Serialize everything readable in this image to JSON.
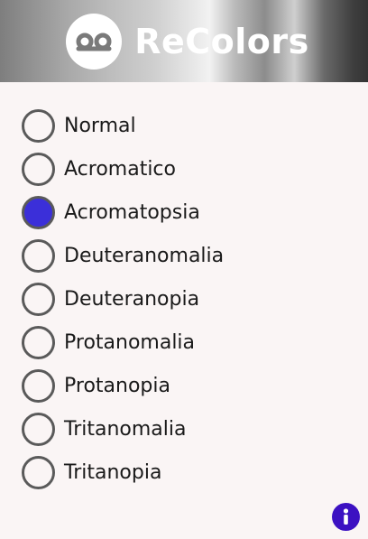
{
  "header": {
    "title": "ReColors",
    "logo_icon": "recolors-logo-icon",
    "logo_color": "#7a7a7a"
  },
  "filters": {
    "selected": "Acromatopsia",
    "accent_color": "#3b2fd9",
    "options": [
      {
        "label": "Normal",
        "checked": false
      },
      {
        "label": "Acromatico",
        "checked": false
      },
      {
        "label": "Acromatopsia",
        "checked": true
      },
      {
        "label": "Deuteranomalia",
        "checked": false
      },
      {
        "label": "Deuteranopia",
        "checked": false
      },
      {
        "label": "Protanomalia",
        "checked": false
      },
      {
        "label": "Protanopia",
        "checked": false
      },
      {
        "label": "Tritanomalia",
        "checked": false
      },
      {
        "label": "Tritanopia",
        "checked": false
      }
    ]
  },
  "info": {
    "icon": "info-icon",
    "color": "#3c11c2"
  }
}
